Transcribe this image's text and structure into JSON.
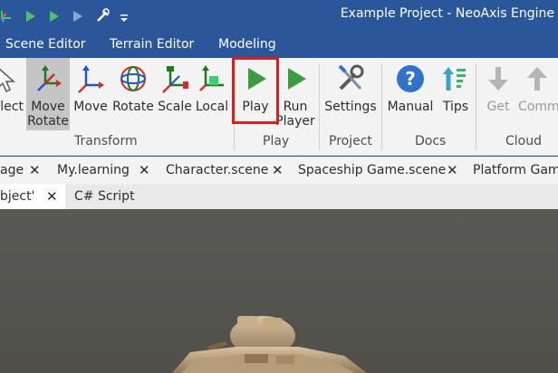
{
  "titlebar": {
    "title": "Example Project - NeoAxis Engine",
    "quick_access": [
      "logo-icon",
      "play-icon",
      "play-icon",
      "play-disabled-icon",
      "wrench-icon",
      "dropdown-icon"
    ]
  },
  "menu": {
    "tabs": [
      "Scene Editor",
      "Terrain Editor",
      "Modeling"
    ]
  },
  "ribbon": {
    "buttons": {
      "select": "lect",
      "move_rotate_line1": "Move",
      "move_rotate_line2": "Rotate",
      "move": "Move",
      "rotate": "Rotate",
      "scale": "Scale",
      "local": "Local",
      "play": "Play",
      "run_player_line1": "Run",
      "run_player_line2": "Player",
      "settings": "Settings",
      "manual": "Manual",
      "tips": "Tips",
      "get": "Get",
      "commit": "Comm"
    },
    "groups": {
      "transform": "Transform",
      "play": "Play",
      "project": "Project",
      "docs": "Docs",
      "cloud": "Cloud"
    }
  },
  "document_tabs": {
    "row1": [
      "age",
      "My.learning",
      "Character.scene",
      "Spaceship Game.scene",
      "Platform Game"
    ],
    "row2": [
      "bject'",
      "C# Script"
    ],
    "close_glyph": "✕"
  },
  "colors": {
    "title_bar": "#2b579a",
    "ribbon_bg": "#f3f3f3",
    "highlight": "#e21b1b",
    "play_green": "#3f9b3f",
    "help_blue": "#2f72c9"
  }
}
